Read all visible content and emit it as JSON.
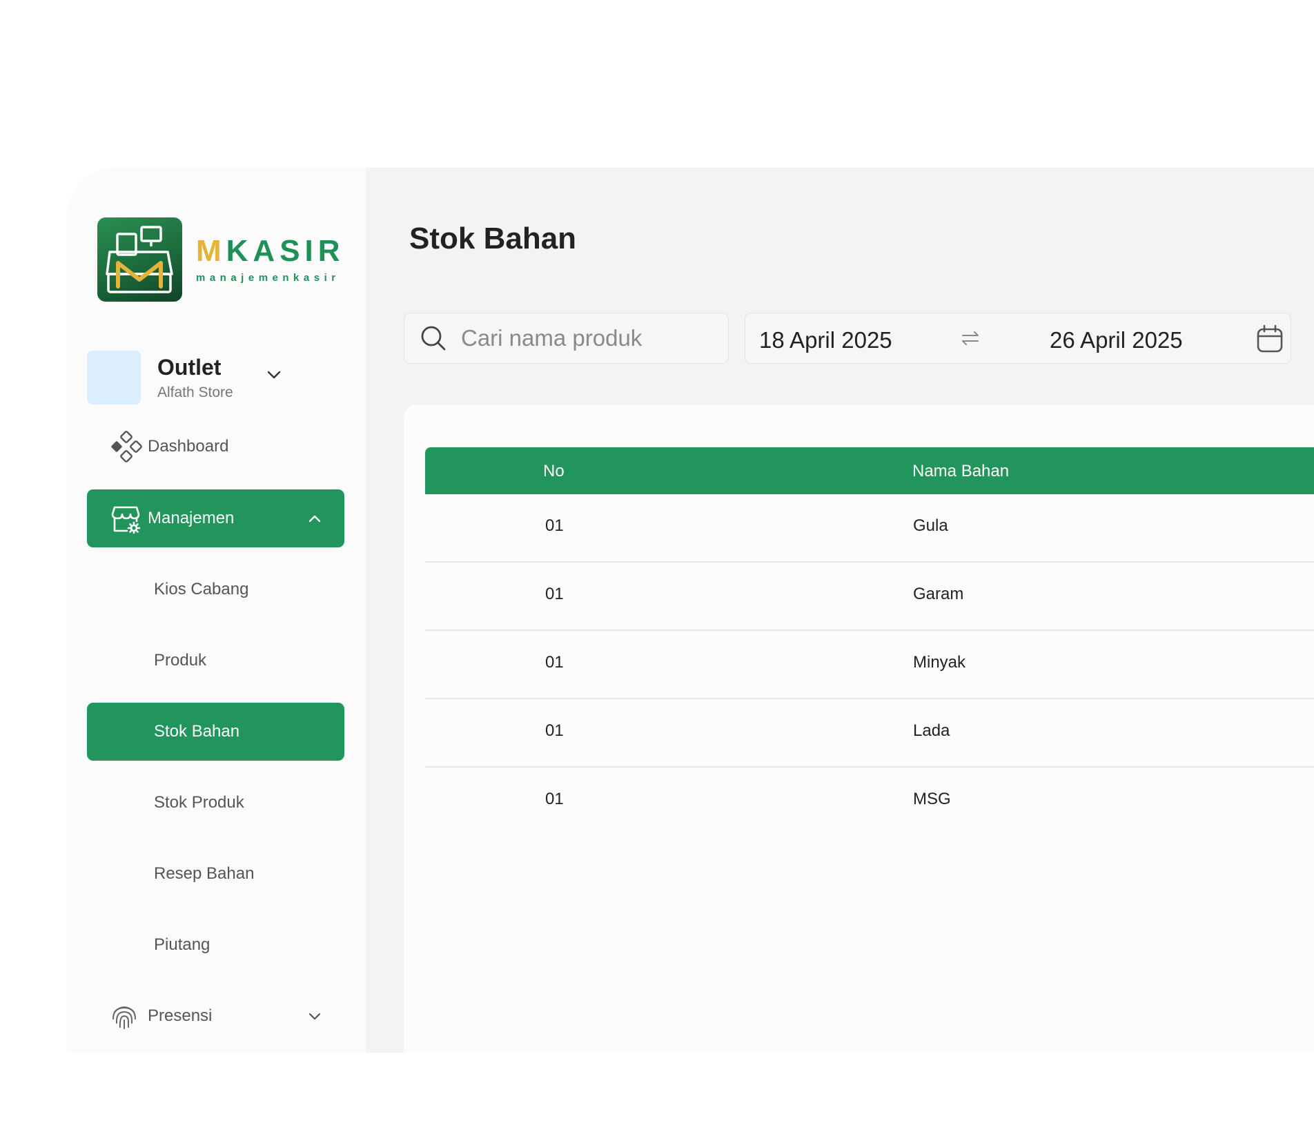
{
  "brand": {
    "word_first": "M",
    "word_rest": "KASIR",
    "tagline": "manajemenkasir"
  },
  "outlet": {
    "title": "Outlet",
    "store": "Alfath Store"
  },
  "nav": {
    "dashboard": "Dashboard",
    "manajemen": "Manajemen",
    "sub_items": [
      "Kios Cabang",
      "Produk",
      "Stok Bahan",
      "Stok Produk",
      "Resep Bahan",
      "Piutang"
    ],
    "presensi": "Presensi"
  },
  "page": {
    "title": "Stok Bahan"
  },
  "search": {
    "placeholder": "Cari nama produk"
  },
  "date_range": {
    "start": "18 April 2025",
    "end": "26 April 2025"
  },
  "table": {
    "columns": [
      "No",
      "Nama Bahan"
    ],
    "rows": [
      {
        "no": "01",
        "name": "Gula"
      },
      {
        "no": "01",
        "name": "Garam"
      },
      {
        "no": "01",
        "name": "Minyak"
      },
      {
        "no": "01",
        "name": "Lada"
      },
      {
        "no": "01",
        "name": "MSG"
      }
    ]
  },
  "colors": {
    "primary": "#22955c",
    "accent_gold": "#e5b23a"
  }
}
